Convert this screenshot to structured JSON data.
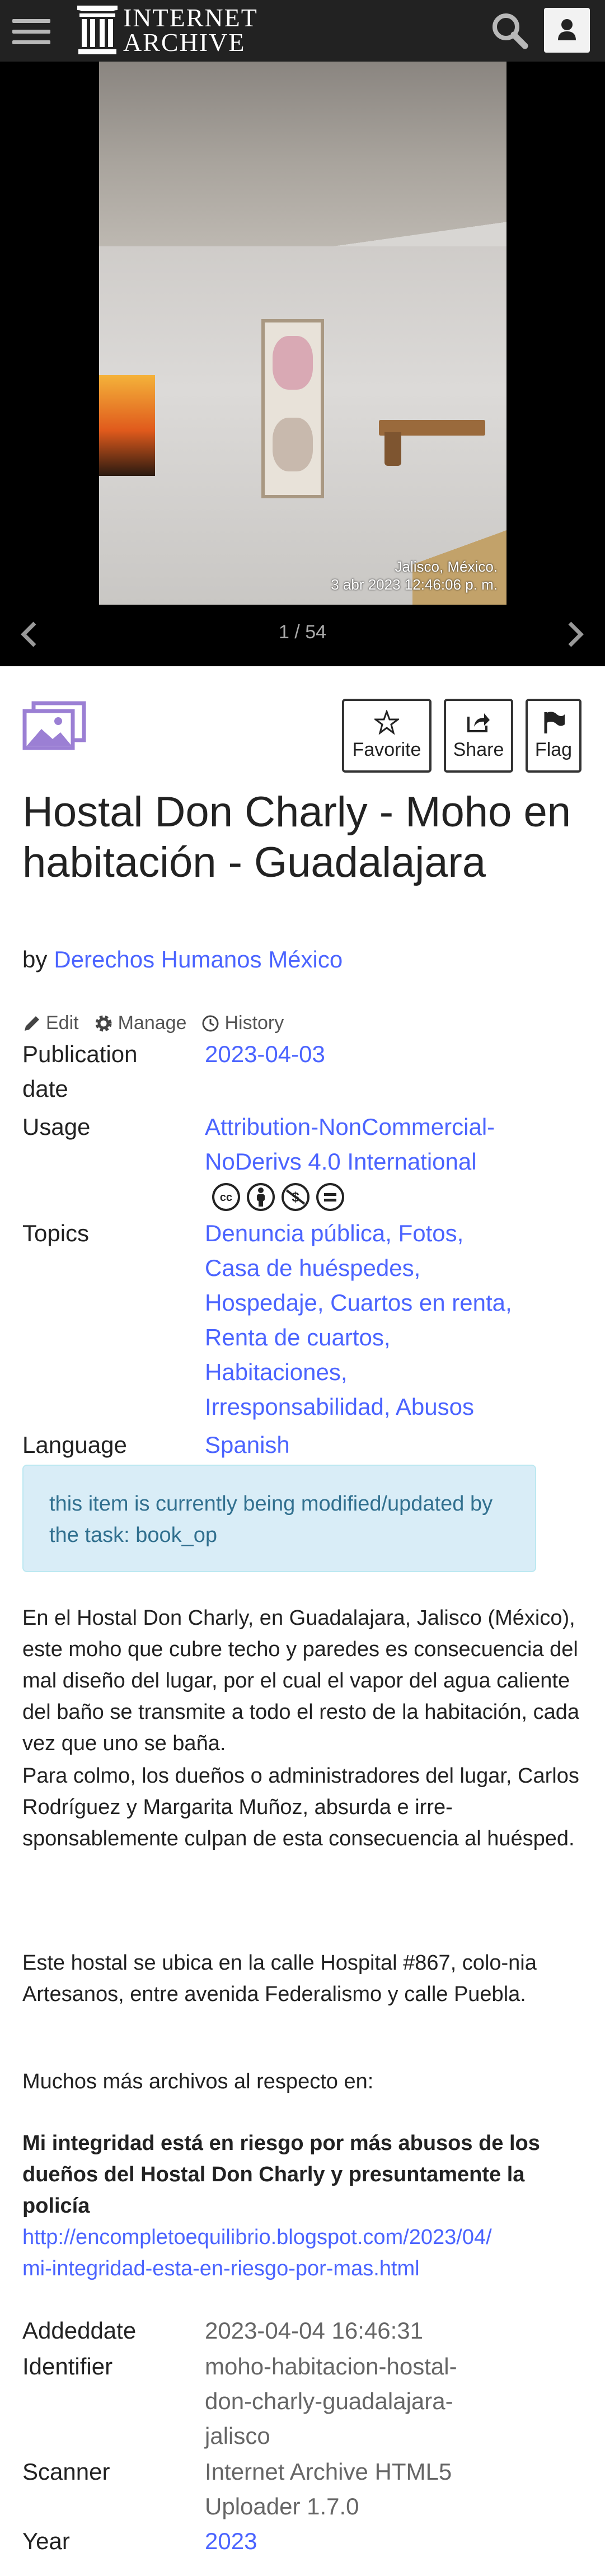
{
  "header": {
    "logo_line1": "INTERNET",
    "logo_line2": "ARCHIVE",
    "menu_icon": "hamburger-icon",
    "search_icon": "search-icon",
    "user_icon": "user-icon"
  },
  "viewer": {
    "stamp_line1": "Jalisco, México.",
    "stamp_line2": "3 abr 2023 12:46:06 p. m.",
    "counter": "1 / 54"
  },
  "actions": {
    "favorite": "Favorite",
    "share": "Share",
    "flag": "Flag"
  },
  "item": {
    "title": "Hostal Don Charly - Moho en habitación - Guadalajara",
    "by": "by",
    "creator": "Derechos Humanos México"
  },
  "tools": {
    "edit": "Edit",
    "manage": "Manage",
    "history": "History"
  },
  "metadata": {
    "publication_label_1": "Publication",
    "publication_label_2": "date",
    "publication_value": "2023-04-03",
    "usage_label": "Usage",
    "usage_value_1": "Attribution-NonCommercial-",
    "usage_value_2": "NoDerivs 4.0 International",
    "topics_label": "Topics",
    "topics": [
      "Denuncia pública",
      "Fotos",
      "Casa de huéspedes",
      "Hospedaje",
      "Cuartos en renta",
      "Renta de cuartos",
      "Habitaciones",
      "Irresponsabilidad",
      "Abusos"
    ],
    "language_label": "Language",
    "language_value": "Spanish"
  },
  "notice": "this item is currently being modified/updated by the task: book_op",
  "description": {
    "p1": "En el Hostal Don Charly, en Guadalajara, Jalisco (México), este moho que cubre techo y paredes es consecuencia del mal diseño del lugar, por el cual el vapor del agua caliente del baño se transmite a todo el resto de la habitación, cada vez que uno se baña.",
    "p2": "Para colmo, los dueños o administradores del lugar, Carlos Rodríguez y Margarita Muñoz, absurda e irre-sponsablemente culpan de esta consecuencia al huésped.",
    "p3": "Este hostal se ubica en la calle Hospital #867, colo-nia Artesanos, entre avenida Federalismo y calle Puebla.",
    "p4": "Muchos más archivos al respecto en:",
    "bold": "Mi integridad está en riesgo por más abusos de los dueños del Hostal Don Charly y presuntamente la policía",
    "link_1": "http://encompletoequilibrio.blogspot.com/2023/04/",
    "link_2": "mi-integridad-esta-en-riesgo-por-mas.html"
  },
  "more_meta": {
    "addeddate_label": "Addeddate",
    "addeddate_value": "2023-04-04 16:46:31",
    "identifier_label": "Identifier",
    "identifier_1": "moho-habitacion-hostal-",
    "identifier_2": "don-charly-guadalajara-",
    "identifier_3": "jalisco",
    "scanner_label": "Scanner",
    "scanner_1": "Internet Archive HTML5",
    "scanner_2": "Uploader 1.7.0",
    "year_label": "Year",
    "year_value": "2023"
  },
  "colors": {
    "topbar": "#222222",
    "link": "#4b64ff",
    "notice_bg": "#d9edf7",
    "notice_text": "#31708f",
    "media_icon": "#9b7fd4"
  }
}
